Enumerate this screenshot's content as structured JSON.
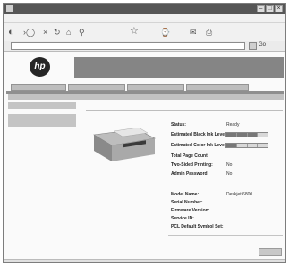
{
  "window": {
    "title": ""
  },
  "toolbar": {
    "back_icon": "back-arrow-icon",
    "forward_icon": "forward-arrow-icon",
    "stop_icon": "stop-icon",
    "refresh_icon": "refresh-icon",
    "home_icon": "home-icon",
    "favorites_icon": "star-icon",
    "mail_icon": "mail-icon",
    "print_icon": "print-icon"
  },
  "address": {
    "url": "",
    "go_label": "Go"
  },
  "header": {
    "logo_text": "hp"
  },
  "tabs": [
    {
      "label": ""
    },
    {
      "label": ""
    },
    {
      "label": ""
    },
    {
      "label": ""
    }
  ],
  "status": {
    "rows": [
      {
        "label": "Status:",
        "value": "Ready"
      },
      {
        "label": "Estimated Black Ink Level:",
        "meter": 0.75
      },
      {
        "label": "Estimated Color Ink Level:",
        "meter": 0.25
      },
      {
        "label": "Total Page Count:",
        "value": ""
      },
      {
        "label": "Two-Sided Printing:",
        "value": "No"
      },
      {
        "label": "Admin Password:",
        "value": "No"
      }
    ]
  },
  "info": {
    "rows": [
      {
        "label": "Model Name:",
        "value": "Deskjet 6800"
      },
      {
        "label": "Serial Number:",
        "value": ""
      },
      {
        "label": "Firmware Version:",
        "value": ""
      },
      {
        "label": "Service ID:",
        "value": ""
      },
      {
        "label": "PCL Default Symbol Set:",
        "value": ""
      }
    ]
  },
  "colors": {
    "banner": "#858585",
    "tab": "#bdbdbd",
    "sidebar": "#c4c4c4"
  }
}
